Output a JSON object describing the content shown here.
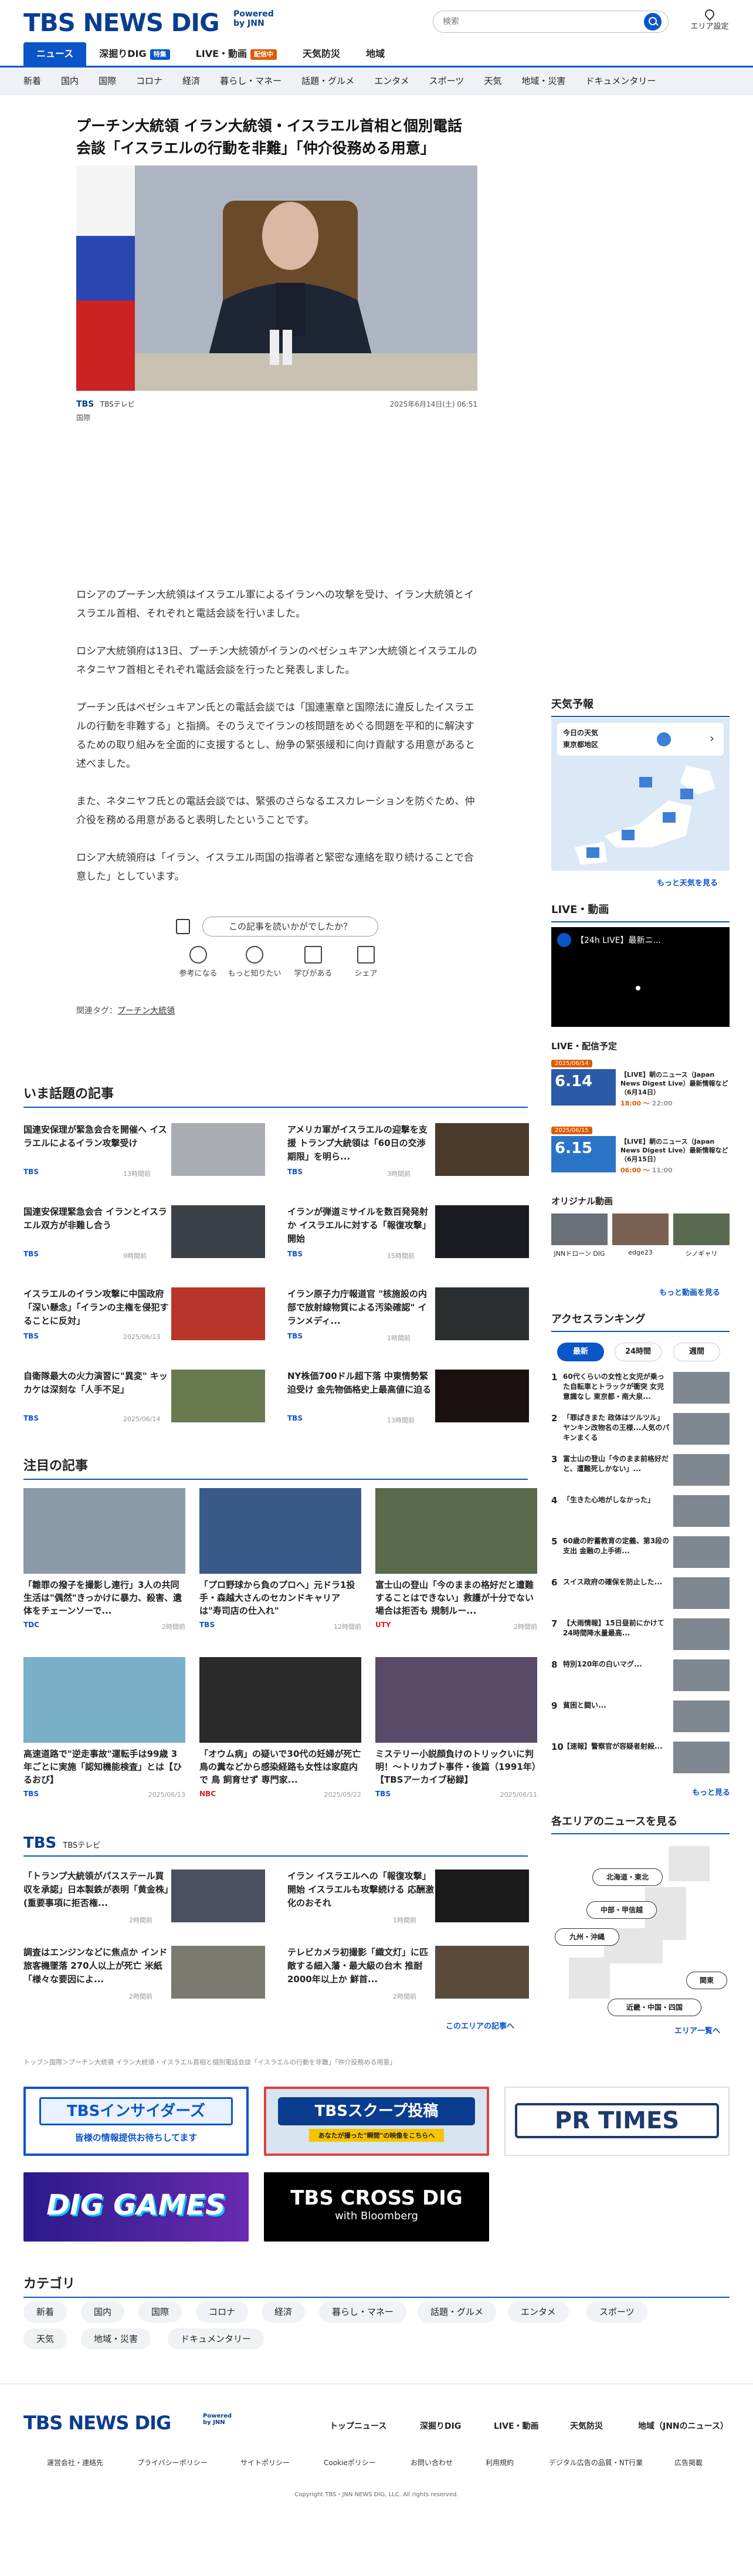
{
  "header": {
    "logo": "TBS NEWS DIG",
    "powered": "Powered by JNN",
    "search_placeholder": "検索",
    "area_label": "エリア設定",
    "nav": [
      {
        "label": "ニュース"
      },
      {
        "label": "深掘りDIG",
        "badge": "特集"
      },
      {
        "label": "LIVE・動画",
        "badge": "配信中"
      },
      {
        "label": "天気防災"
      },
      {
        "label": "地域"
      }
    ],
    "subnav": [
      "新着",
      "国内",
      "国際",
      "コロナ",
      "経済",
      "暮らし・マネー",
      "話題・グルメ",
      "エンタメ",
      "スポーツ",
      "天気",
      "地域・災害",
      "ドキュメンタリー"
    ]
  },
  "article": {
    "title": "プーチン大統領 イラン大統領・イスラエル首相と個別電話会談「イスラエルの行動を非難」「仲介役務める用意」",
    "source_logo": "TBS",
    "source_name": "TBSテレビ",
    "category": "国際",
    "datetime": "2025年6月14日(土) 06:51",
    "paragraphs": [
      "ロシアのプーチン大統領はイスラエル軍によるイランへの攻撃を受け、イラン大統領とイスラエル首相、それぞれと電話会談を行いました。",
      "ロシア大統領府は13日、プーチン大統領がイランのペゼシュキアン大統領とイスラエルのネタニヤフ首相とそれぞれ電話会談を行ったと発表しました。",
      "プーチン氏はペゼシュキアン氏との電話会談では「国連憲章と国際法に違反したイスラエルの行動を非難する」と指摘。そのうえでイランの核問題をめぐる問題を平和的に解決するための取り組みを全面的に支援するとし、紛争の緊張緩和に向け貢献する用意があると述べました。",
      "また、ネタニヤフ氏との電話会談では、緊張のさらなるエスカレーションを防ぐため、仲介役を務める用意があると表明したということです。",
      "ロシア大統領府は「イラン、イスラエル両国の指導者と緊密な連絡を取り続けることで合意した」としています。"
    ],
    "feedback_prompt": "この記事を読いかがでしたか？",
    "reactions": [
      "参考になる",
      "もっと知りたい",
      "学びがある",
      "シェア"
    ],
    "tags_label": "関連タグ：",
    "tag": "プーチン大統領"
  },
  "sidebar": {
    "weather_title": "天気予報",
    "weather_today": "今日の天気",
    "weather_region": "東京都地区",
    "weather_more": "もっと天気を見る",
    "live_title": "LIVE・動画",
    "live_video_title": "【24h LIVE】最新ニ...",
    "schedule_title": "LIVE・配信予定",
    "schedule": [
      {
        "date": "2025/06/14",
        "title": "【LIVE】朝のニュース（Japan News Digest Live）最新情報など（6月14日）",
        "time": "18:00",
        "end": "22:00",
        "thumb": "6.14"
      },
      {
        "date": "2025/06/15",
        "title": "【LIVE】朝のニュース（Japan News Digest Live）最新情報など（6月15日）",
        "time": "06:00",
        "end": "11:00",
        "thumb": "6.15"
      }
    ],
    "original_title": "オリジナル動画",
    "originals": [
      "JNNドローン DIG",
      "edge23",
      "シノギャリ"
    ],
    "original_more": "もっと動画を見る",
    "ranking_title": "アクセスランキング",
    "ranking_tabs": [
      "最新",
      "24時間",
      "週間"
    ],
    "ranking": [
      "60代くらいの女性と女児が乗った自転車とトラックが衝突 女児意識なし 東京都・南大泉...",
      "「罪ばきまた 政体はツルツル」ヤンキン改物名の王様...人気のパキンまくる",
      "富士山の登山「今のまま前格好だと、遭難死しかない」...",
      "「生きた心地がしなかった」",
      "60歳の貯蓄教育の定義、第3段の支出 金融の上手術...",
      "スイス政府の確保を防止した...",
      "【大雨情報】15日昼前にかけて 24時間降水量最高...",
      "特別120年の白いマグ...",
      "貧困と闘い...",
      "【速報】警察官が容疑者射殺..."
    ],
    "ranking_more": "もっと見る",
    "area_title": "各エリアのニュースを見る",
    "areas": [
      "北海道・東北",
      "中部・甲信越",
      "九州・沖縄",
      "関東",
      "近畿・中国・四国"
    ],
    "area_more": "エリア一覧へ"
  },
  "trending": {
    "title": "いま話題の記事",
    "items": [
      {
        "title": "国連安保理が緊急会合を開催へ イスラエルによるイラン攻撃受け",
        "src": "TBS",
        "time": "13時間前"
      },
      {
        "title": "アメリカ軍がイスラエルの迎撃を支援 トランプ大統領は「60日の交渉期限」を明ら...",
        "src": "TBS",
        "time": "3時間前"
      },
      {
        "title": "国連安保理緊急会合 イランとイスラエル双方が非難し合う",
        "src": "TBS",
        "time": "9時間前"
      },
      {
        "title": "イランが弾道ミサイルを数百発発射か イスラエルに対する「報復攻撃」開始",
        "src": "TBS",
        "time": "15時間前"
      },
      {
        "title": "イスラエルのイラン攻撃に中国政府「深い懸念」「イランの主権を侵犯することに反対」",
        "src": "TBS",
        "time": "2025/06/13"
      },
      {
        "title": "イラン原子力庁報道官 \"核施設の内部で放射線物質による汚染確認\" イランメディ...",
        "src": "TBS",
        "time": "1時間前"
      },
      {
        "title": "自衛隊最大の火力演習に\"異変\" キッカケは深刻な「人手不足」",
        "src": "TBS",
        "time": "2025/06/14"
      },
      {
        "title": "NY株価700ドル超下落 中東情勢緊迫受け 金先物価格史上最高値に迫る",
        "src": "TBS",
        "time": "13時間前"
      }
    ]
  },
  "featured": {
    "title": "注目の記事",
    "items": [
      {
        "title": "「雛罪の撥子を撮影し連行」3人の共同生活は\"偶然\"きっかけに暴力、殺害、遺体をチェーンソーで...",
        "src": "TDC",
        "time": "2時間前"
      },
      {
        "title": "「プロ野球から負のプロへ」元ドラ1投手・森越大さんのセカンドキャリアは\"寿司店の仕入れ\"",
        "src": "TBS",
        "time": "12時間前"
      },
      {
        "title": "富士山の登山「今のままの格好だと遭難することはできない」救護が十分でない場合は拒否も 規制ルー...",
        "src": "UTY",
        "time": "2時間前"
      },
      {
        "title": "高速道路で\"逆走事故\"運転手は99歳 3年ごとに実施「認知機能検査」とは【ひるおび】",
        "src": "TBS",
        "time": "2025/06/13"
      },
      {
        "title": "「オウム病」の疑いで30代の妊婦が死亡 鳥の糞などから感染経路も女性は家庭内で 鳥 飼育せず 専門家...",
        "src": "NBC",
        "time": "2025/05/22"
      },
      {
        "title": "ミステリー小説顔負けのトリックいに判明！〜トリカブト事件・後篇（1991年）【TBSアーカイブ秘録】",
        "src": "TBS",
        "time": "2025/06/11"
      }
    ]
  },
  "tbs_section": {
    "logo": "TBS",
    "label": "TBSテレビ",
    "items": [
      {
        "title": "「トランプ大統領がパスステール買収を承認」日本製鉄が表明「黄金株」(重要事項に拒否権...",
        "time": "2時間前"
      },
      {
        "title": "イラン イスラエルへの「報復攻撃」開始 イスラエルも攻撃続ける 応酬激化のおそれ",
        "time": "1時間前"
      },
      {
        "title": "調査はエンジンなどに焦点か インド旅客機墜落 270人以上が死亡 米紙「様々な要因によ...",
        "time": "2時間前"
      },
      {
        "title": "テレビカメラ初撮影「織文灯」に匹敵する細入藩・最大級の台木 推耐2000年以上か 鮮首...",
        "time": "2時間前"
      }
    ],
    "more": "このエリアの記事へ"
  },
  "breadcrumb": "トップ＞国際＞プーチン大統領 イラン大統領・イスラエル首相と個別電話会談「イスラエルの行動を非難」「仲介役務める用意」",
  "banners": {
    "insider_title": "TBSインサイダーズ",
    "insider_sub": "皆様の情報提供お待ちしてます",
    "scoop_title": "TBSスクープ投稿",
    "scoop_sub": "あなたが撮った\"瞬間\"の映像をこちらへ",
    "prtimes": "PR TIMES",
    "diggames": "DIG GAMES",
    "crossdig_title": "TBS CROSS DIG",
    "crossdig_sub": "with Bloomberg"
  },
  "categories": {
    "title": "カテゴリ",
    "items": [
      "新着",
      "国内",
      "国際",
      "コロナ",
      "経済",
      "暮らし・マネー",
      "話題・グルメ",
      "エンタメ",
      "スポーツ",
      "天気",
      "地域・災害",
      "ドキュメンタリー"
    ]
  },
  "footer": {
    "logo": "TBS NEWS DIG",
    "powered": "Powered by JNN",
    "nav": [
      "トップニュース",
      "深掘りDIG",
      "LIVE・動画",
      "天気防災",
      "地域（JNNのニュース）"
    ],
    "links": [
      "運営会社・連絡先",
      "プライバシーポリシー",
      "サイトポリシー",
      "Cookieポリシー",
      "お問い合わせ",
      "利用規約",
      "デジタル広告の品質・NT行業",
      "広告掲載"
    ],
    "copyright": "Copyright TBS・JNN NEWS DIG, LLC. All rights reserved."
  },
  "colors": {
    "brand": "#0a3d8f",
    "accent": "#0a55c8",
    "live": "#e05a00"
  }
}
